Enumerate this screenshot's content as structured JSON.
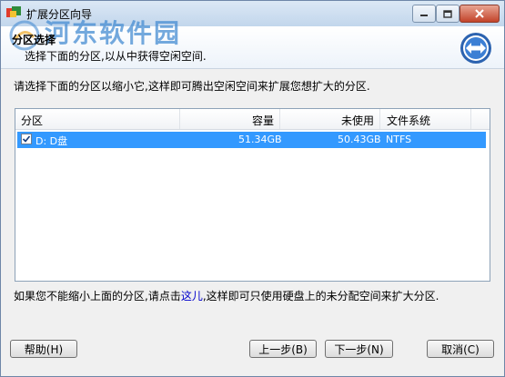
{
  "window": {
    "title": "扩展分区向导"
  },
  "header": {
    "title": "分区选择",
    "subtitle": "选择下面的分区,以从中获得空闲空间.",
    "watermark": "河东软件园"
  },
  "prompt": "请选择下面的分区以缩小它,这样即可腾出空闲空间来扩展您想扩大的分区.",
  "table": {
    "columns": [
      "分区",
      "容量",
      "未使用",
      "文件系统"
    ],
    "rows": [
      {
        "checked": true,
        "partition": "D: D盘",
        "capacity": "51.34GB",
        "unused": "50.43GB",
        "fs": "NTFS"
      }
    ]
  },
  "bottom": {
    "text_before": "如果您不能缩小上面的分区,请点击",
    "link": "这儿",
    "text_after": ",这样即可只使用硬盘上的未分配空间来扩大分区."
  },
  "buttons": {
    "help": "帮助(H)",
    "back": "上一步(B)",
    "next": "下一步(N)",
    "cancel": "取消(C)"
  },
  "icons": {
    "app": "app-icon",
    "minimize": "minimize-icon",
    "maximize": "maximize-icon",
    "close": "close-icon",
    "nav": "resize-arrows-icon"
  },
  "colors": {
    "selection": "#3399ff",
    "link": "#0000cc"
  }
}
